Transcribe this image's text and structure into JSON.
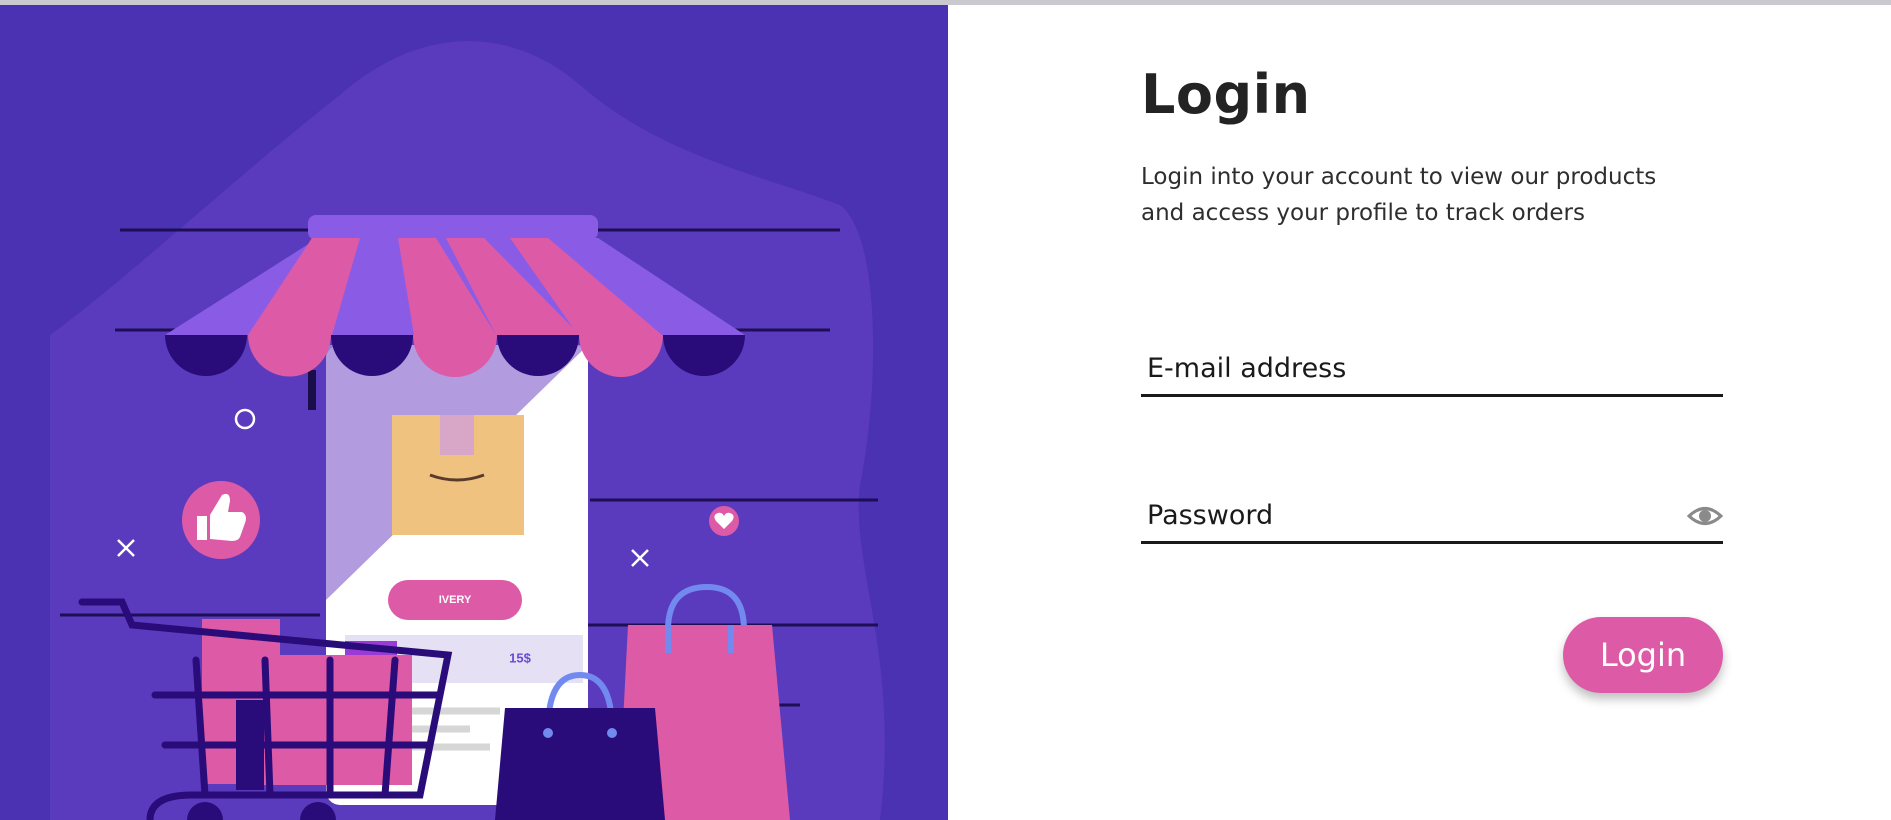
{
  "login": {
    "title": "Login",
    "subtitle": "Login into your account to view our products and access your profile to track orders",
    "email_placeholder": "E-mail address",
    "password_placeholder": "Password",
    "submit_label": "Login"
  },
  "illustration": {
    "button_text": "IVERY",
    "price_text": "15$",
    "icons": [
      "shop-awning-icon",
      "thumbs-up-icon",
      "heart-icon",
      "shopping-cart-icon",
      "shopping-bag-icon",
      "cardboard-box-icon"
    ]
  },
  "colors": {
    "illustration_bg": "#4b32b3",
    "accent_pink": "#dd5aa6",
    "awning_purple": "#8a5ce6",
    "text_dark": "#232323"
  }
}
